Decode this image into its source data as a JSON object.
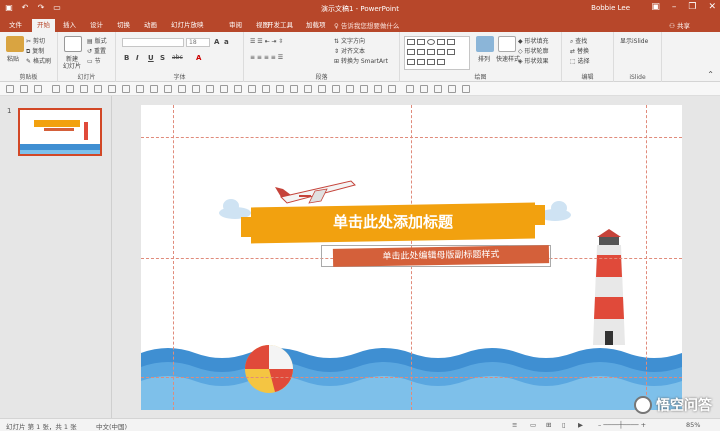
{
  "window": {
    "title": "演示文稿1 - PowerPoint",
    "user": "Bobbie Lee",
    "controls": [
      "minimize",
      "restore",
      "close"
    ]
  },
  "tabs": [
    "文件",
    "开始",
    "插入",
    "设计",
    "切换",
    "动画",
    "幻灯片放映",
    "审阅",
    "视图",
    "开发工具",
    "加载项"
  ],
  "active_tab": "开始",
  "tell_me": "告诉我您想要做什么",
  "share": "共享",
  "ribbon": {
    "clipboard": {
      "label": "剪贴板",
      "paste": "粘贴",
      "cut": "剪切",
      "copy": "复制",
      "format_painter": "格式刷"
    },
    "slides": {
      "label": "幻灯片",
      "new_slide": "新建",
      "new_slide_line2": "幻灯片",
      "layout": "版式",
      "reset": "重置",
      "section": "节"
    },
    "font": {
      "label": "字体",
      "font_name": "",
      "font_size": "18",
      "b": "B",
      "i": "I",
      "u": "U",
      "s": "S",
      "abc": "abc"
    },
    "paragraph": {
      "label": "段落",
      "text_direction": "文字方向",
      "align_text": "对齐文本",
      "smartart": "转换为 SmartArt"
    },
    "drawing": {
      "label": "绘图",
      "arrange": "排列",
      "quick_styles": "快速样式",
      "fill": "形状填充",
      "outline": "形状轮廓",
      "effects": "形状效果"
    },
    "editing": {
      "label": "编辑",
      "find": "查找",
      "replace": "替换",
      "select": "选择"
    },
    "islide": {
      "label": "iSlide",
      "show": "显示iSlide"
    }
  },
  "thumbnail": {
    "number": "1"
  },
  "slide": {
    "title": "单击此处添加标题",
    "subtitle": "单击此处编辑母版副标题样式"
  },
  "statusbar": {
    "slide_info": "幻灯片 第 1 张，共 1 张",
    "language": "中文(中国)",
    "zoom": "85%"
  },
  "watermark": "悟空问答",
  "colors": {
    "accent": "#b7472a",
    "banner": "#f2a10f",
    "subtitle_band": "#d4603a",
    "wave_dark": "#3f8fd2",
    "wave_light": "#7ec0ea"
  }
}
